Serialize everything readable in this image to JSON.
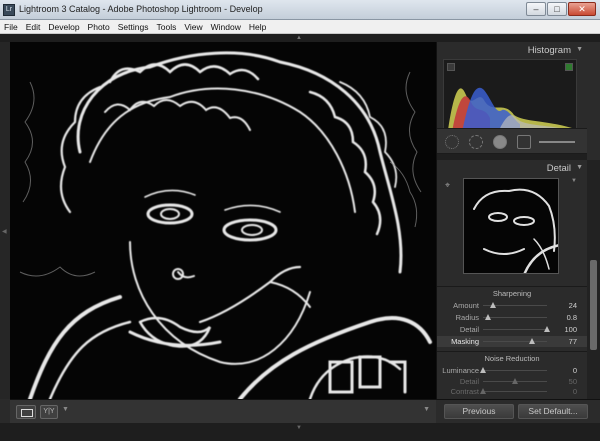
{
  "window": {
    "title": "Lightroom 3 Catalog - Adobe Photoshop Lightroom - Develop",
    "icon_letters": "Lr"
  },
  "menu": [
    "File",
    "Edit",
    "Develop",
    "Photo",
    "Settings",
    "Tools",
    "View",
    "Window",
    "Help"
  ],
  "panels": {
    "histogram_title": "Histogram",
    "detail_title": "Detail"
  },
  "sharpening": {
    "section_title": "Sharpening",
    "sliders": [
      {
        "label": "Amount",
        "value": "24",
        "fraction": 0.16
      },
      {
        "label": "Radius",
        "value": "0.8",
        "fraction": 0.08
      },
      {
        "label": "Detail",
        "value": "100",
        "fraction": 1.0
      },
      {
        "label": "Masking",
        "value": "77",
        "fraction": 0.77
      }
    ]
  },
  "noise_reduction": {
    "section_title": "Noise Reduction",
    "sliders": [
      {
        "label": "Luminance",
        "value": "0",
        "fraction": 0.0
      },
      {
        "label": "Detail",
        "value": "50",
        "fraction": 0.5
      },
      {
        "label": "Contrast",
        "value": "0",
        "fraction": 0.0
      }
    ]
  },
  "buttons": {
    "previous": "Previous",
    "set_default": "Set Default..."
  },
  "view_modes": {
    "split": "Y|Y"
  },
  "colors": {
    "panel_bg": "#2b2b2b",
    "image_bg": "#050505",
    "close_button": "#c94a33"
  }
}
